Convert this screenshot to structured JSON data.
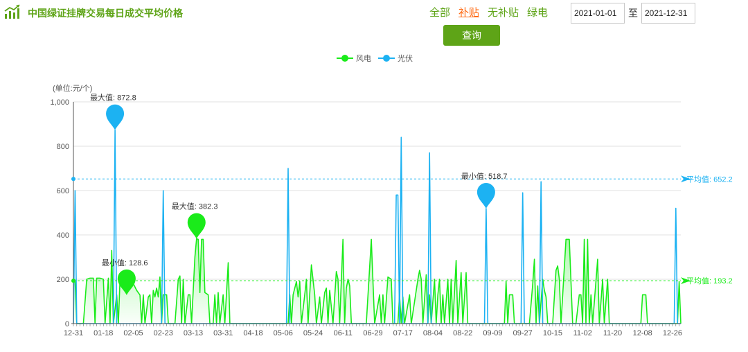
{
  "header": {
    "title": "中国绿证挂牌交易每日成交平均价格",
    "filters": [
      {
        "label": "全部",
        "active": false
      },
      {
        "label": "补贴",
        "active": true
      },
      {
        "label": "无补贴",
        "active": false
      },
      {
        "label": "绿电",
        "active": false
      }
    ],
    "date_from": "2021-01-01",
    "date_sep": "至",
    "date_to": "2021-12-31",
    "query_label": "查询",
    "title_color": "#5ea417"
  },
  "chart_data": {
    "type": "area",
    "ylabel": "(单位:元/个)",
    "ylim": [
      0,
      1000
    ],
    "yticks": [
      "0",
      "200",
      "400",
      "600",
      "800",
      "1,000"
    ],
    "xlabels": [
      "12-31",
      "01-18",
      "02-05",
      "02-23",
      "03-13",
      "03-31",
      "04-18",
      "05-06",
      "05-24",
      "06-11",
      "06-29",
      "07-17",
      "08-04",
      "08-22",
      "09-09",
      "09-27",
      "10-15",
      "11-02",
      "11-20",
      "12-08",
      "12-26"
    ],
    "xlabel_start": "2020-12-31",
    "xlabel_step_days": 18,
    "grid": true,
    "legend_position": "top-center",
    "series": [
      {
        "name": "风电",
        "color": "#1aeb1a",
        "average": 193.2,
        "average_label": "平均值: 193.2",
        "max": {
          "label": "最大值: 382.3",
          "date": "2021-03-15",
          "value": 382.3
        },
        "min": {
          "label": "最小值: 128.6",
          "date": "2021-02-01",
          "value": 128.6
        },
        "points": [
          [
            "2020-12-31",
            195
          ],
          [
            "2021-01-01",
            195
          ],
          [
            "2021-01-02",
            0
          ],
          [
            "2021-01-06",
            0
          ],
          [
            "2021-01-08",
            200
          ],
          [
            "2021-01-10",
            205
          ],
          [
            "2021-01-12",
            205
          ],
          [
            "2021-01-13",
            0
          ],
          [
            "2021-01-14",
            205
          ],
          [
            "2021-01-16",
            205
          ],
          [
            "2021-01-18",
            200
          ],
          [
            "2021-01-19",
            0
          ],
          [
            "2021-01-21",
            205
          ],
          [
            "2021-01-22",
            0
          ],
          [
            "2021-01-23",
            330
          ],
          [
            "2021-01-24",
            0
          ],
          [
            "2021-01-26",
            130
          ],
          [
            "2021-01-27",
            0
          ],
          [
            "2021-01-28",
            200
          ],
          [
            "2021-01-30",
            205
          ],
          [
            "2021-02-01",
            160
          ],
          [
            "2021-02-03",
            200
          ],
          [
            "2021-02-05",
            180
          ],
          [
            "2021-02-07",
            150
          ],
          [
            "2021-02-09",
            128.6
          ],
          [
            "2021-02-10",
            0
          ],
          [
            "2021-02-11",
            130
          ],
          [
            "2021-02-12",
            0
          ],
          [
            "2021-02-14",
            120
          ],
          [
            "2021-02-15",
            130
          ],
          [
            "2021-02-16",
            0
          ],
          [
            "2021-02-17",
            150
          ],
          [
            "2021-02-18",
            120
          ],
          [
            "2021-02-19",
            160
          ],
          [
            "2021-02-20",
            120
          ],
          [
            "2021-02-21",
            210
          ],
          [
            "2021-02-22",
            0
          ],
          [
            "2021-02-23",
            130
          ],
          [
            "2021-02-25",
            130
          ],
          [
            "2021-02-26",
            0
          ],
          [
            "2021-03-02",
            0
          ],
          [
            "2021-03-04",
            200
          ],
          [
            "2021-03-05",
            215
          ],
          [
            "2021-03-06",
            0
          ],
          [
            "2021-03-07",
            200
          ],
          [
            "2021-03-08",
            0
          ],
          [
            "2021-03-10",
            130
          ],
          [
            "2021-03-11",
            130
          ],
          [
            "2021-03-12",
            0
          ],
          [
            "2021-03-14",
            300
          ],
          [
            "2021-03-15",
            382.3
          ],
          [
            "2021-03-16",
            380
          ],
          [
            "2021-03-17",
            140
          ],
          [
            "2021-03-18",
            380
          ],
          [
            "2021-03-19",
            380
          ],
          [
            "2021-03-20",
            140
          ],
          [
            "2021-03-22",
            130
          ],
          [
            "2021-03-23",
            0
          ],
          [
            "2021-03-25",
            0
          ],
          [
            "2021-03-26",
            130
          ],
          [
            "2021-03-27",
            0
          ],
          [
            "2021-03-28",
            140
          ],
          [
            "2021-03-29",
            0
          ],
          [
            "2021-03-31",
            130
          ],
          [
            "2021-04-01",
            0
          ],
          [
            "2021-04-03",
            275
          ],
          [
            "2021-04-04",
            0
          ],
          [
            "2021-05-09",
            0
          ],
          [
            "2021-05-10",
            130
          ],
          [
            "2021-05-11",
            0
          ],
          [
            "2021-05-12",
            130
          ],
          [
            "2021-05-14",
            190
          ],
          [
            "2021-05-15",
            120
          ],
          [
            "2021-05-16",
            190
          ],
          [
            "2021-05-17",
            0
          ],
          [
            "2021-05-19",
            130
          ],
          [
            "2021-05-20",
            200
          ],
          [
            "2021-05-21",
            0
          ],
          [
            "2021-05-23",
            265
          ],
          [
            "2021-05-25",
            130
          ],
          [
            "2021-05-26",
            0
          ],
          [
            "2021-05-28",
            120
          ],
          [
            "2021-05-29",
            0
          ],
          [
            "2021-05-31",
            140
          ],
          [
            "2021-06-01",
            160
          ],
          [
            "2021-06-02",
            0
          ],
          [
            "2021-06-03",
            150
          ],
          [
            "2021-06-05",
            0
          ],
          [
            "2021-06-07",
            235
          ],
          [
            "2021-06-08",
            200
          ],
          [
            "2021-06-09",
            0
          ],
          [
            "2021-06-11",
            380
          ],
          [
            "2021-06-12",
            0
          ],
          [
            "2021-06-13",
            160
          ],
          [
            "2021-06-14",
            200
          ],
          [
            "2021-06-15",
            170
          ],
          [
            "2021-06-16",
            0
          ],
          [
            "2021-06-25",
            0
          ],
          [
            "2021-06-28",
            380
          ],
          [
            "2021-06-30",
            0
          ],
          [
            "2021-07-03",
            130
          ],
          [
            "2021-07-04",
            0
          ],
          [
            "2021-07-05",
            130
          ],
          [
            "2021-07-06",
            0
          ],
          [
            "2021-07-08",
            210
          ],
          [
            "2021-07-10",
            200
          ],
          [
            "2021-07-11",
            0
          ],
          [
            "2021-07-14",
            0
          ],
          [
            "2021-07-15",
            130
          ],
          [
            "2021-07-16",
            0
          ],
          [
            "2021-07-17",
            120
          ],
          [
            "2021-07-18",
            0
          ],
          [
            "2021-07-21",
            130
          ],
          [
            "2021-07-22",
            0
          ],
          [
            "2021-07-26",
            200
          ],
          [
            "2021-07-27",
            240
          ],
          [
            "2021-07-28",
            200
          ],
          [
            "2021-07-29",
            0
          ],
          [
            "2021-07-31",
            220
          ],
          [
            "2021-08-01",
            0
          ],
          [
            "2021-08-02",
            130
          ],
          [
            "2021-08-03",
            0
          ],
          [
            "2021-08-05",
            200
          ],
          [
            "2021-08-06",
            0
          ],
          [
            "2021-08-07",
            130
          ],
          [
            "2021-08-08",
            200
          ],
          [
            "2021-08-09",
            0
          ],
          [
            "2021-08-10",
            130
          ],
          [
            "2021-08-11",
            0
          ],
          [
            "2021-08-13",
            200
          ],
          [
            "2021-08-14",
            0
          ],
          [
            "2021-08-15",
            200
          ],
          [
            "2021-08-16",
            0
          ],
          [
            "2021-08-18",
            285
          ],
          [
            "2021-08-19",
            0
          ],
          [
            "2021-08-21",
            230
          ],
          [
            "2021-08-22",
            0
          ],
          [
            "2021-08-24",
            230
          ],
          [
            "2021-08-25",
            0
          ],
          [
            "2021-09-16",
            0
          ],
          [
            "2021-09-17",
            190
          ],
          [
            "2021-09-18",
            0
          ],
          [
            "2021-09-19",
            130
          ],
          [
            "2021-09-21",
            130
          ],
          [
            "2021-09-22",
            0
          ],
          [
            "2021-10-01",
            0
          ],
          [
            "2021-10-03",
            180
          ],
          [
            "2021-10-04",
            290
          ],
          [
            "2021-10-05",
            0
          ],
          [
            "2021-10-06",
            170
          ],
          [
            "2021-10-07",
            0
          ],
          [
            "2021-10-09",
            200
          ],
          [
            "2021-10-10",
            150
          ],
          [
            "2021-10-11",
            120
          ],
          [
            "2021-10-12",
            0
          ],
          [
            "2021-10-15",
            0
          ],
          [
            "2021-10-17",
            240
          ],
          [
            "2021-10-18",
            260
          ],
          [
            "2021-10-19",
            200
          ],
          [
            "2021-10-20",
            0
          ],
          [
            "2021-10-23",
            380
          ],
          [
            "2021-10-25",
            380
          ],
          [
            "2021-10-27",
            0
          ],
          [
            "2021-10-29",
            0
          ],
          [
            "2021-10-31",
            130
          ],
          [
            "2021-11-01",
            130
          ],
          [
            "2021-11-02",
            0
          ],
          [
            "2021-11-03",
            380
          ],
          [
            "2021-11-04",
            0
          ],
          [
            "2021-11-05",
            380
          ],
          [
            "2021-11-06",
            0
          ],
          [
            "2021-11-07",
            130
          ],
          [
            "2021-11-08",
            0
          ],
          [
            "2021-11-11",
            290
          ],
          [
            "2021-11-12",
            0
          ],
          [
            "2021-11-14",
            200
          ],
          [
            "2021-11-15",
            0
          ],
          [
            "2021-11-17",
            200
          ],
          [
            "2021-11-18",
            0
          ],
          [
            "2021-12-07",
            0
          ],
          [
            "2021-12-08",
            130
          ],
          [
            "2021-12-10",
            130
          ],
          [
            "2021-12-11",
            0
          ],
          [
            "2021-12-24",
            0
          ],
          [
            "2021-12-29",
            0
          ],
          [
            "2021-12-30",
            190
          ],
          [
            "2021-12-31",
            0
          ]
        ]
      },
      {
        "name": "光伏",
        "color": "#1cb2f2",
        "average": 652.2,
        "average_label": "平均值: 652.2",
        "max": {
          "label": "最大值: 872.8",
          "date": "2021-01-25",
          "value": 872.8
        },
        "min": {
          "label": "最小值: 518.7",
          "date": "2021-09-05",
          "value": 518.7
        },
        "points": [
          [
            "2020-12-31",
            0
          ],
          [
            "2021-01-01",
            600
          ],
          [
            "2021-01-02",
            0
          ],
          [
            "2021-01-24",
            0
          ],
          [
            "2021-01-25",
            872.8
          ],
          [
            "2021-01-26",
            0
          ],
          [
            "2021-02-22",
            0
          ],
          [
            "2021-02-23",
            600
          ],
          [
            "2021-02-24",
            0
          ],
          [
            "2021-05-08",
            0
          ],
          [
            "2021-05-09",
            700
          ],
          [
            "2021-05-10",
            0
          ],
          [
            "2021-07-12",
            0
          ],
          [
            "2021-07-13",
            580
          ],
          [
            "2021-07-14",
            580
          ],
          [
            "2021-07-15",
            0
          ],
          [
            "2021-07-16",
            840
          ],
          [
            "2021-07-17",
            0
          ],
          [
            "2021-08-01",
            0
          ],
          [
            "2021-08-02",
            770
          ],
          [
            "2021-08-03",
            0
          ],
          [
            "2021-09-04",
            0
          ],
          [
            "2021-09-05",
            518.7
          ],
          [
            "2021-09-06",
            0
          ],
          [
            "2021-09-26",
            0
          ],
          [
            "2021-09-27",
            590
          ],
          [
            "2021-09-28",
            0
          ],
          [
            "2021-10-07",
            0
          ],
          [
            "2021-10-08",
            640
          ],
          [
            "2021-10-09",
            0
          ],
          [
            "2021-12-27",
            0
          ],
          [
            "2021-12-28",
            520
          ],
          [
            "2021-12-29",
            0
          ],
          [
            "2021-12-31",
            0
          ]
        ]
      }
    ]
  }
}
